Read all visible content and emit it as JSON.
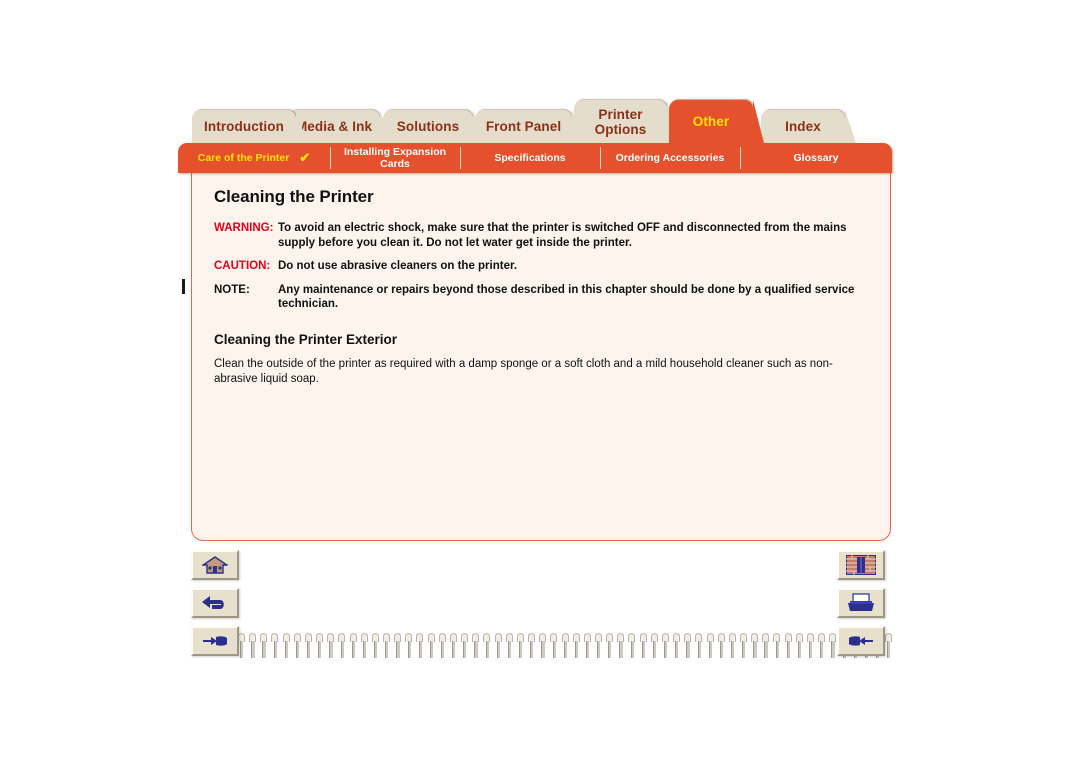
{
  "tabs": [
    {
      "label": "Introduction",
      "active": false,
      "two_line": false
    },
    {
      "label": "Media & Ink",
      "active": false,
      "two_line": false
    },
    {
      "label": "Solutions",
      "active": false,
      "two_line": false
    },
    {
      "label": "Front Panel",
      "active": false,
      "two_line": false
    },
    {
      "label": "Printer\nOptions",
      "active": false,
      "two_line": true
    },
    {
      "label": "Other",
      "active": true,
      "two_line": false
    },
    {
      "label": "Index",
      "active": false,
      "two_line": false
    }
  ],
  "subtabs": [
    {
      "label": "Care of the Printer",
      "current": true,
      "check": "✔"
    },
    {
      "label": "Installing Expansion\nCards",
      "current": false,
      "check": ""
    },
    {
      "label": "Specifications",
      "current": false,
      "check": ""
    },
    {
      "label": "Ordering Accessories",
      "current": false,
      "check": ""
    },
    {
      "label": "Glossary",
      "current": false,
      "check": ""
    }
  ],
  "page": {
    "title": "Cleaning the Printer",
    "admonitions": [
      {
        "tag": "WARNING:",
        "tag_color": "#e2001a",
        "text": "To avoid an electric shock, make sure that the printer is switched OFF and disconnected from the mains supply before you clean it. Do not let water get inside the printer."
      },
      {
        "tag": "CAUTION:",
        "tag_color": "#e2001a",
        "text": "Do not use abrasive cleaners on the printer."
      },
      {
        "tag": "NOTE:",
        "tag_color": "#111111",
        "text": "Any maintenance or repairs beyond those described in this chapter should be done by a qualified service technician."
      }
    ],
    "section_heading": "Cleaning the Printer Exterior",
    "section_body": "Clean the outside of the printer as required with a damp sponge or a soft cloth and a mild household cleaner such as non-abrasive liquid soap."
  },
  "nav_buttons": {
    "left": [
      {
        "icon": "home-icon"
      },
      {
        "icon": "back-arrow-icon"
      },
      {
        "icon": "pointing-hand-left-icon"
      }
    ],
    "right": [
      {
        "icon": "bookshelf-index-icon"
      },
      {
        "icon": "printer-icon"
      },
      {
        "icon": "pointing-hand-right-icon"
      }
    ]
  },
  "colors": {
    "accent_orange": "#e5502d",
    "tab_beige": "#e4ddcb",
    "tab_text": "#8c3018",
    "active_tab_text": "#ffe400",
    "page_bg": "#fdf5ed",
    "page_border": "#e8674a",
    "warning_red": "#e2001a"
  },
  "spiral": {
    "ring_count": 59
  }
}
